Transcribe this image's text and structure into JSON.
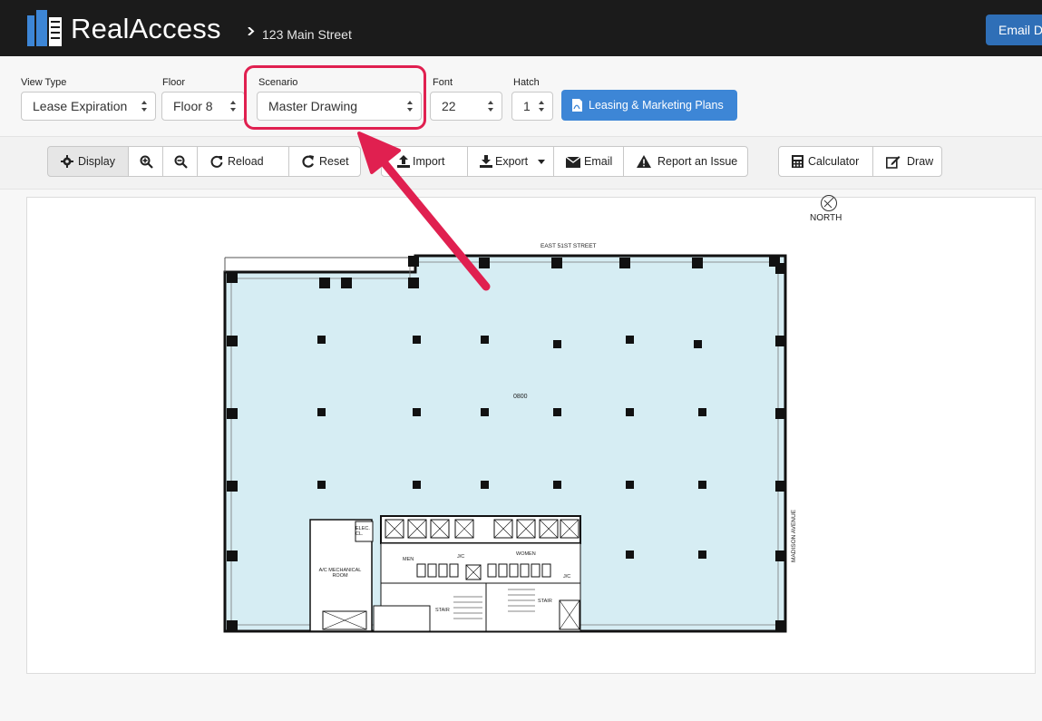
{
  "header": {
    "brand": "RealAccess",
    "breadcrumb": "123 Main Street",
    "email_button": "Email D"
  },
  "filters": {
    "view_type": {
      "label": "View Type",
      "value": "Lease Expiration"
    },
    "floor": {
      "label": "Floor",
      "value": "Floor 8"
    },
    "scenario": {
      "label": "Scenario",
      "value": "Master Drawing"
    },
    "font": {
      "label": "Font",
      "value": "22"
    },
    "hatch": {
      "label": "Hatch",
      "value": "1"
    },
    "leasing_button": "Leasing & Marketing Plans"
  },
  "toolbar": {
    "display": "Display",
    "reload": "Reload",
    "reset": "Reset",
    "import": "Import",
    "export": "Export",
    "email": "Email",
    "report": "Report an Issue",
    "calculator": "Calculator",
    "draw": "Draw"
  },
  "floorplan": {
    "north": "NORTH",
    "street_top": "EAST 51ST STREET",
    "street_right": "MADISON AVENUE",
    "suite": "0800",
    "rooms": {
      "elec": "ELEC. CL.",
      "mech": "A/C MECHANICAL ROOM",
      "men": "MEN",
      "women": "WOMEN",
      "jc1": "J/C",
      "jc2": "J/C",
      "stair1": "STAIR",
      "stair2": "STAIR",
      "pe": "P.E."
    }
  },
  "colors": {
    "topbar": "#1b1b1b",
    "accent_blue": "#3d86d6",
    "highlight": "#e02050",
    "floor_fill": "#d6edf3"
  }
}
